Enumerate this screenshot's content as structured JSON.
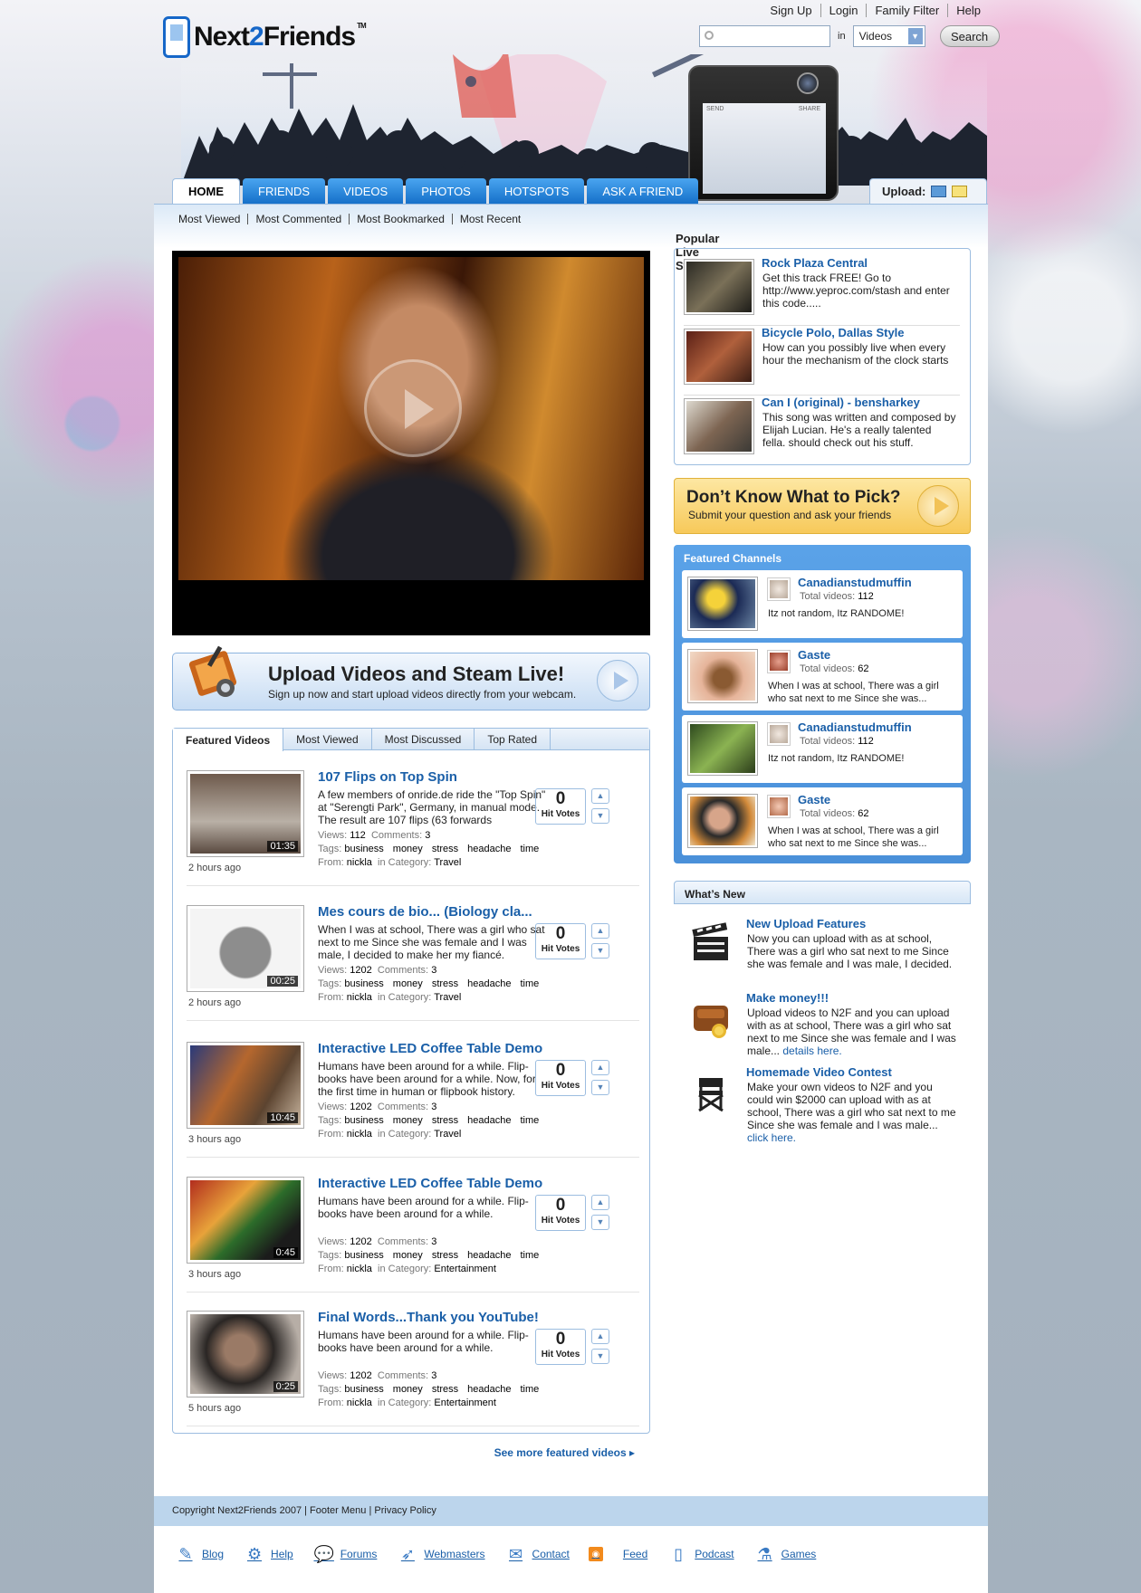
{
  "header": {
    "logo": {
      "part1": "Next",
      "part2": "2",
      "part3": "Friends",
      "tm": "TM"
    },
    "top_links": [
      "Sign Up",
      "Login",
      "Family Filter",
      "Help"
    ],
    "search": {
      "value": "",
      "in_label": "in",
      "category": "Videos",
      "button": "Search"
    },
    "phone_labels": {
      "send": "SEND",
      "share": "SHARE"
    }
  },
  "nav": {
    "tabs": [
      "HOME",
      "FRIENDS",
      "VIDEOS",
      "PHOTOS",
      "HOTSPOTS",
      "ASK A FRIEND"
    ],
    "active": "HOME",
    "upload_label": "Upload:"
  },
  "subnav": [
    "Most Viewed",
    "Most Commented",
    "Most Bookmarked",
    "Most Recent"
  ],
  "upload_banner": {
    "title": "Upload Videos and Steam Live!",
    "subtitle": "Sign up now and start upload videos directly from your webcam."
  },
  "featured_videos": {
    "tabs": [
      "Featured Videos",
      "Most Viewed",
      "Most Discussed",
      "Top Rated"
    ],
    "labels": {
      "views": "Views:",
      "comments": "Comments:",
      "tags": "Tags:",
      "from": "From:",
      "category": "in Category:",
      "hit_votes": "Hit Votes"
    },
    "videos": [
      {
        "title": "107 Flips on Top Spin",
        "description": "A few members of onride.de ride the \"Top Spin\" at \"Serengti Park\", Germany, in manual mode. The result are 107 flips (63 forwards",
        "duration": "01:35",
        "time_ago": "2 hours ago",
        "views": "112",
        "comments": "3",
        "tags": [
          "business",
          "money",
          "stress",
          "headache",
          "time"
        ],
        "from": "nickla",
        "category": "Travel",
        "votes": "0"
      },
      {
        "title": "Mes cours de bio... (Biology cla...",
        "description": "When I was at school, There was a girl who sat next to me Since she was female and I was male, I decided to make her my fiancé.",
        "duration": "00:25",
        "time_ago": "2 hours ago",
        "views": "1202",
        "comments": "3",
        "tags": [
          "business",
          "money",
          "stress",
          "headache",
          "time"
        ],
        "from": "nickla",
        "category": "Travel",
        "votes": "0"
      },
      {
        "title": "Interactive LED Coffee Table Demo",
        "description": "Humans have been around for a while. Flip-books have been around for a while. Now, for the first time in human or flipbook history.",
        "duration": "10:45",
        "time_ago": "3 hours ago",
        "views": "1202",
        "comments": "3",
        "tags": [
          "business",
          "money",
          "stress",
          "headache",
          "time"
        ],
        "from": "nickla",
        "category": "Travel",
        "votes": "0"
      },
      {
        "title": "Interactive LED Coffee Table Demo",
        "description": "Humans have been around for a while. Flip-books have been around for a while.",
        "duration": "0:45",
        "time_ago": "3 hours ago",
        "views": "1202",
        "comments": "3",
        "tags": [
          "business",
          "money",
          "stress",
          "headache",
          "time"
        ],
        "from": "nickla",
        "category": "Entertainment",
        "votes": "0"
      },
      {
        "title": "Final Words...Thank you YouTube!",
        "description": "Humans have been around for a while. Flip-books have been around for a while.",
        "duration": "0:25",
        "time_ago": "5 hours ago",
        "views": "1202",
        "comments": "3",
        "tags": [
          "business",
          "money",
          "stress",
          "headache",
          "time"
        ],
        "from": "nickla",
        "category": "Entertainment",
        "votes": "0"
      }
    ],
    "more_link": "See more featured videos ▸"
  },
  "popular_live": {
    "title": "Popular Live Steams",
    "items": [
      {
        "title": "Rock Plaza Central",
        "description": "Get this track FREE! Go to http://www.yeproc.com/stash and enter this code....."
      },
      {
        "title": "Bicycle Polo, Dallas Style",
        "description": "How can you possibly live when every hour the mechanism of the clock starts"
      },
      {
        "title": "Can I (original) - bensharkey",
        "description": "This song was written and composed by Elijah Lucian. He's a really talented fella. should check out his stuff."
      }
    ]
  },
  "ask_banner": {
    "title": "Don’t Know What to Pick?",
    "subtitle": "Submit your question and ask your friends"
  },
  "featured_channels": {
    "title": "Featured Channels",
    "total_label": "Total videos:",
    "items": [
      {
        "name": "Canadianstudmuffin",
        "total": "112",
        "description": "Itz not random, Itz RANDOME!"
      },
      {
        "name": "Gaste",
        "total": "62",
        "description": "When I was at school, There was a girl who sat next to me Since she was..."
      },
      {
        "name": "Canadianstudmuffin",
        "total": "112",
        "description": "Itz not random, Itz RANDOME!"
      },
      {
        "name": "Gaste",
        "total": "62",
        "description": "When I was at school, There was a girl who sat next to me Since she was..."
      }
    ]
  },
  "whats_new": {
    "title": "What’s New",
    "items": [
      {
        "title": "New Upload Features",
        "description": "Now you can upload with as at school, There was a girl who sat next to me Since she was female and I was male, I decided.",
        "link": "",
        "icon": "clapperboard-icon"
      },
      {
        "title": "Make money!!!",
        "description": "Upload videos to N2F and you can upload with as at school, There was a girl who sat next to me Since she was female and I was male... ",
        "link": "details here.",
        "icon": "wallet-icon"
      },
      {
        "title": "Homemade Video Contest",
        "description": "Make your own videos to N2F and you could win $2000 can upload with as at school, There was a girl who sat next to me Since she was female and I was male... ",
        "link": "click here.",
        "icon": "directors-chair-icon"
      }
    ]
  },
  "footer": {
    "copyright": "Copyright Next2Friends 2007 | Footer Menu | Privacy Policy",
    "links": [
      "Blog",
      "Help",
      "Forums",
      "Webmasters",
      "Contact",
      "Feed",
      "Podcast",
      "Games"
    ]
  },
  "colors": {
    "accent": "#1a5fa8",
    "tab_blue": "#1570c9",
    "panel_border": "#9cbde0",
    "ask_yellow": "#f7c95a"
  }
}
